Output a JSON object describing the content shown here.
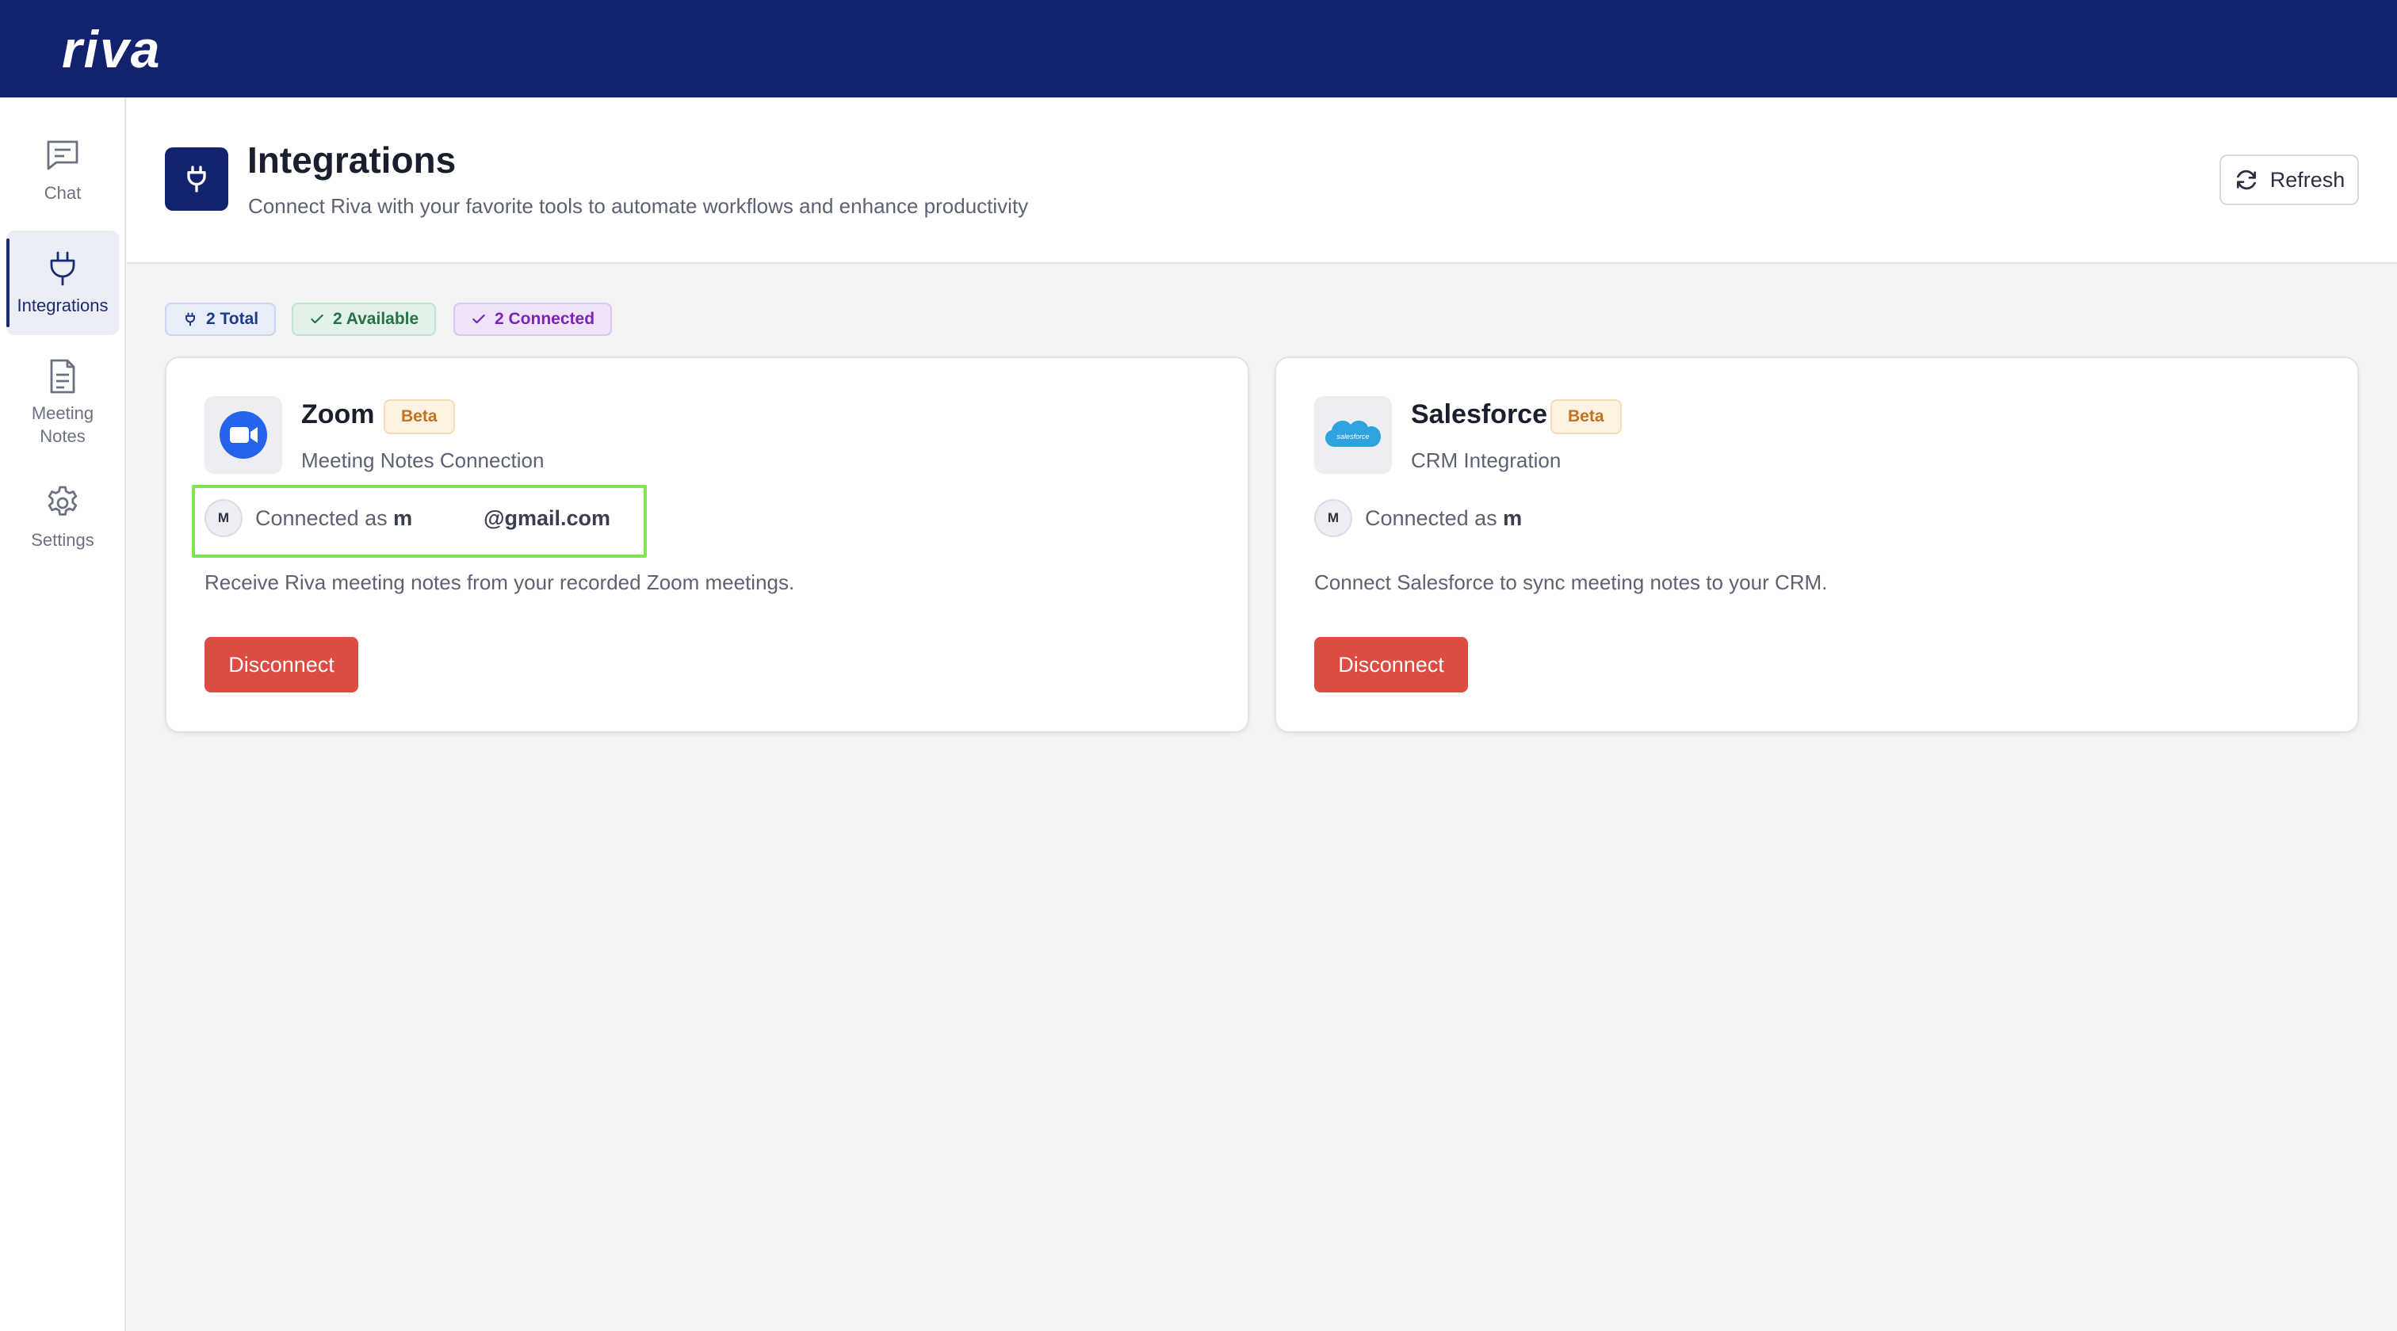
{
  "brand": {
    "logo_text": "riva"
  },
  "sidebar": {
    "items": [
      {
        "label": "Chat",
        "icon": "chat-icon"
      },
      {
        "label": "Integrations",
        "icon": "plug-icon",
        "active": true
      },
      {
        "label": "Meeting Notes",
        "icon": "document-icon"
      },
      {
        "label": "Settings",
        "icon": "gear-icon"
      }
    ]
  },
  "header": {
    "title": "Integrations",
    "subtitle": "Connect Riva with your favorite tools to automate workflows and enhance productivity",
    "refresh_label": "Refresh"
  },
  "stats": {
    "total": "2 Total",
    "available": "2 Available",
    "connected": "2 Connected"
  },
  "integrations": [
    {
      "name": "Zoom",
      "badge": "Beta",
      "subtitle": "Meeting Notes Connection",
      "avatar_initial": "M",
      "connected_prefix": "Connected as ",
      "connected_account": "m            @gmail.com",
      "description": "Receive Riva meeting notes from your recorded Zoom meetings.",
      "action_label": "Disconnect",
      "icon": "zoom-logo",
      "highlighted": true
    },
    {
      "name": "Salesforce",
      "badge": "Beta",
      "subtitle": "CRM Integration",
      "avatar_initial": "M",
      "connected_prefix": "Connected as ",
      "connected_account": "m",
      "description": "Connect Salesforce to sync meeting notes to your CRM.",
      "action_label": "Disconnect",
      "icon": "salesforce-logo",
      "logo_text": "salesforce"
    }
  ],
  "colors": {
    "topbar": "#13226e",
    "accent": "#13226e",
    "danger": "#dc4c43",
    "beta": "#c5721a",
    "highlight": "#7ee84b"
  }
}
